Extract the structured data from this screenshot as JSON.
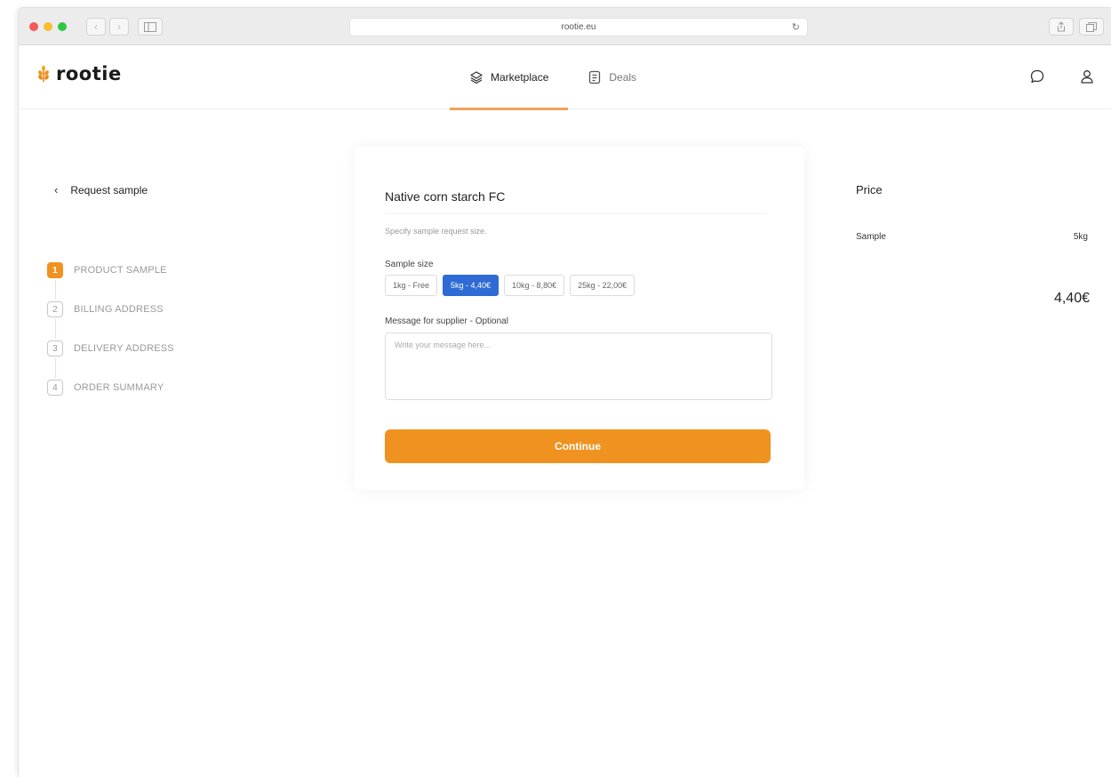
{
  "browser": {
    "url": "rootie.eu"
  },
  "app": {
    "logo_text": "rootie",
    "nav": [
      {
        "label": "Marketplace",
        "icon": "layers-icon",
        "active": true
      },
      {
        "label": "Deals",
        "icon": "deals-icon",
        "active": false
      }
    ]
  },
  "sidebar": {
    "back_label": "Request sample",
    "steps": [
      {
        "num": "1",
        "label": "PRODUCT SAMPLE",
        "active": true
      },
      {
        "num": "2",
        "label": "BILLING ADDRESS",
        "active": false
      },
      {
        "num": "3",
        "label": "DELIVERY ADDRESS",
        "active": false
      },
      {
        "num": "4",
        "label": "ORDER SUMMARY",
        "active": false
      }
    ]
  },
  "form": {
    "title": "Native corn starch FC",
    "subtitle": "Specify sample request size.",
    "sample_size_label": "Sample size",
    "sizes": [
      {
        "label": "1kg - Free",
        "selected": false
      },
      {
        "label": "5kg - 4,40€",
        "selected": true
      },
      {
        "label": "10kg - 8,80€",
        "selected": false
      },
      {
        "label": "25kg - 22,00€",
        "selected": false
      }
    ],
    "message_label": "Message for supplier - Optional",
    "message_placeholder": "Write your message here...",
    "message_value": "",
    "continue_label": "Continue"
  },
  "price": {
    "title": "Price",
    "row_label": "Sample",
    "row_value": "5kg",
    "total": "4,40€"
  },
  "colors": {
    "accent": "#f0921f",
    "selected": "#2e6bd4",
    "nav_underline": "#f0a35a"
  }
}
